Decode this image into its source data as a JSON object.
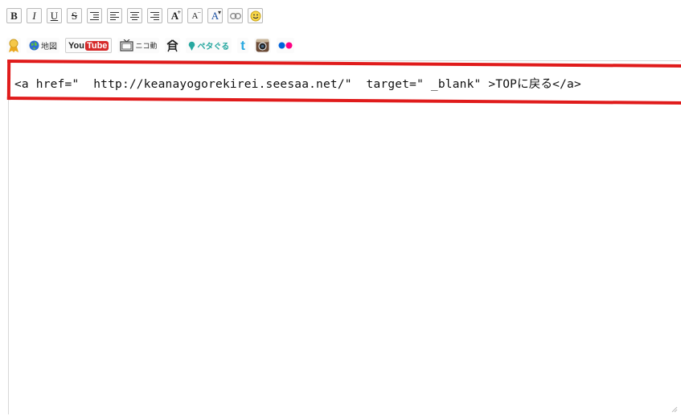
{
  "toolbar": {
    "bold_label": "B",
    "italic_label": "I",
    "underline_label": "U",
    "strike_label": "S",
    "font_plus_label": "A",
    "font_plus_sup": "+",
    "font_minus_label": "A",
    "font_minus_sup": "−",
    "font_color_label": "A",
    "font_color_sup": "▾",
    "smiley_icon": "☺",
    "map_label": "地図",
    "youtube_you": "You",
    "youtube_tube": "Tube",
    "nico_label": "ニコ動",
    "petaguru_label": "ペタぐる",
    "twitter_label": "t"
  },
  "editor": {
    "content": "<a href=\"  http://keanayogorekirei.seesaa.net/\"  target=\" _blank\" >TOPに戻る</a>"
  },
  "colors": {
    "highlight": "#e01b1b",
    "youtube_red": "#d62a2a",
    "twitter_blue": "#2aa9e0",
    "flickr_blue": "#0063dc",
    "flickr_pink": "#ff0084"
  }
}
